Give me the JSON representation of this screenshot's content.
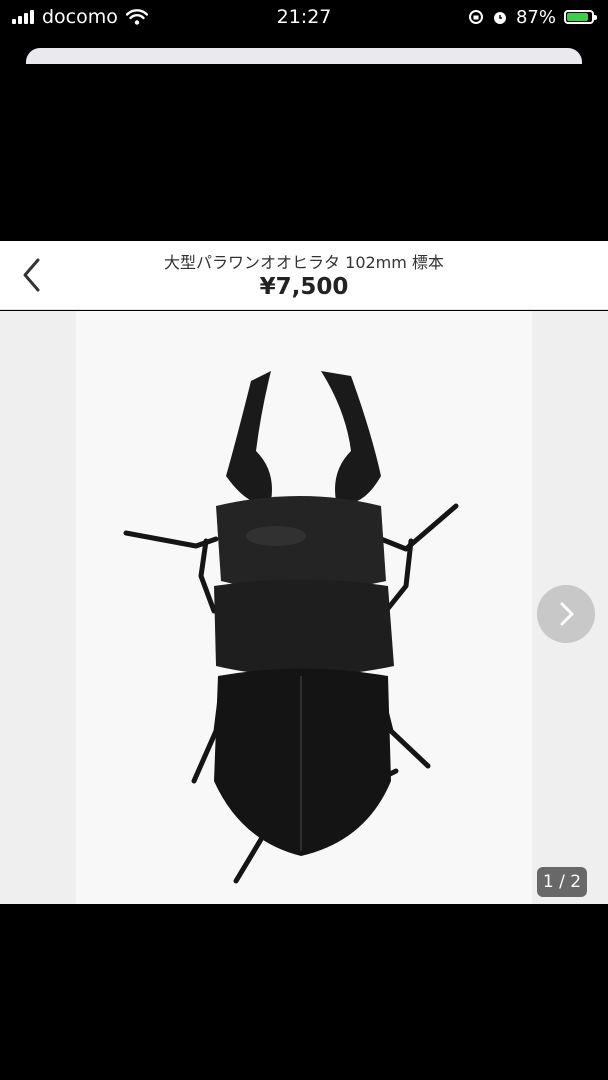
{
  "status_bar": {
    "carrier": "docomo",
    "time": "21:27",
    "battery_percent": "87%",
    "battery_level": 0.87,
    "battery_color": "#3ccf4e"
  },
  "listing": {
    "title": "大型パラワンオオヒラタ 102mm 標本",
    "price": "¥7,500"
  },
  "gallery": {
    "counter": "1 / 2",
    "next_icon": "chevron-right-icon",
    "back_icon": "chevron-left-icon"
  }
}
